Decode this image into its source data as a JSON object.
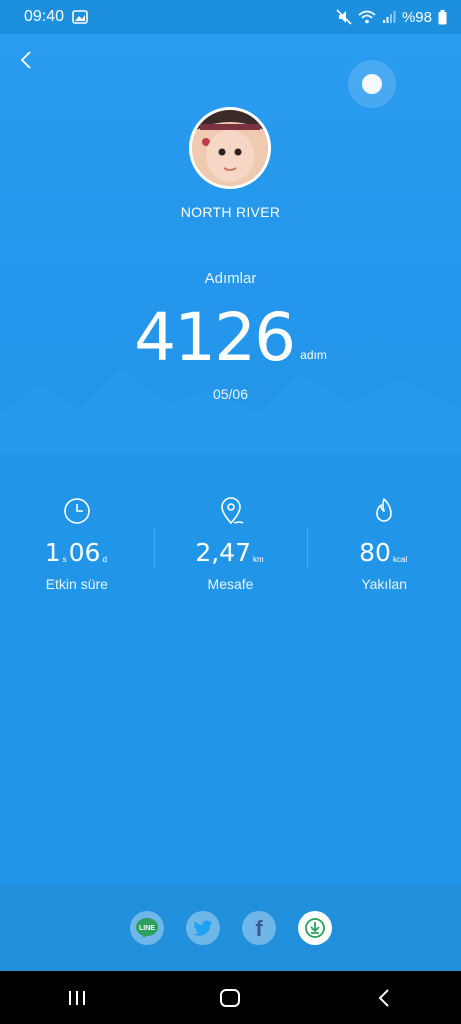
{
  "status_bar": {
    "time": "09:40",
    "battery": "%98",
    "icons": [
      "gallery-icon",
      "mute-icon",
      "wifi-icon",
      "signal-icon",
      "battery-icon"
    ]
  },
  "header": {
    "back_icon": "chevron-left-icon",
    "weather_icon": "sun-icon"
  },
  "profile": {
    "name": "NORTH RIVER",
    "avatar": "avatar-photo"
  },
  "steps": {
    "label": "Adımlar",
    "value": "4126",
    "unit": "adım",
    "date": "05/06"
  },
  "stats": [
    {
      "icon": "clock-icon",
      "value_a": "1",
      "sub_a": "s",
      "value_b": "06",
      "sub_b": "d",
      "label": "Etkin süre"
    },
    {
      "icon": "location-pin-icon",
      "value": "2,47",
      "unit": "km",
      "label": "Mesafe"
    },
    {
      "icon": "flame-icon",
      "value": "80",
      "unit": "kcal",
      "label": "Yakılan"
    }
  ],
  "share": {
    "buttons": [
      {
        "name": "line",
        "icon": "line-icon",
        "label": "LINE"
      },
      {
        "name": "twitter",
        "icon": "twitter-icon"
      },
      {
        "name": "facebook",
        "icon": "facebook-icon",
        "label": "f"
      },
      {
        "name": "download",
        "icon": "download-icon"
      }
    ]
  },
  "colors": {
    "background": "#2196e8",
    "accent": "#2aa05a"
  }
}
